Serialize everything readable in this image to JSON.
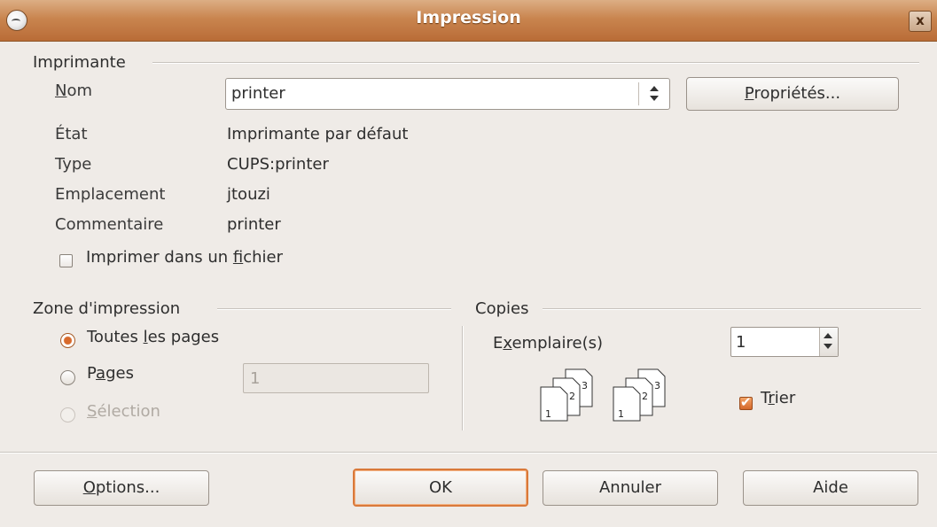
{
  "window": {
    "title": "Impression",
    "close_label": "x"
  },
  "printer_section": {
    "title": "Imprimante",
    "name_label": "Nom",
    "name_value": "printer",
    "properties_button": "Propriétés...",
    "state_label": "État",
    "state_value": "Imprimante par défaut",
    "type_label": "Type",
    "type_value": "CUPS:printer",
    "location_label": "Emplacement",
    "location_value": "jtouzi",
    "comment_label": "Commentaire",
    "comment_value": "printer",
    "print_to_file": {
      "label": "Imprimer dans un fichier",
      "checked": false
    }
  },
  "print_range": {
    "title": "Zone d'impression",
    "all_pages": {
      "label": "Toutes les pages",
      "selected": true
    },
    "pages": {
      "label": "Pages",
      "selected": false,
      "value": "1"
    },
    "selection": {
      "label": "Sélection",
      "enabled": false
    }
  },
  "copies": {
    "title": "Copies",
    "count_label": "Exemplaire(s)",
    "count_value": "1",
    "collate": {
      "label": "Trier",
      "checked": true
    },
    "page_numbers": [
      "1",
      "2",
      "3"
    ]
  },
  "buttons": {
    "options": "Options...",
    "ok": "OK",
    "cancel": "Annuler",
    "help": "Aide"
  },
  "colors": {
    "titlebar": "#c9854f",
    "accent": "#d9793a",
    "background": "#efebe7"
  }
}
